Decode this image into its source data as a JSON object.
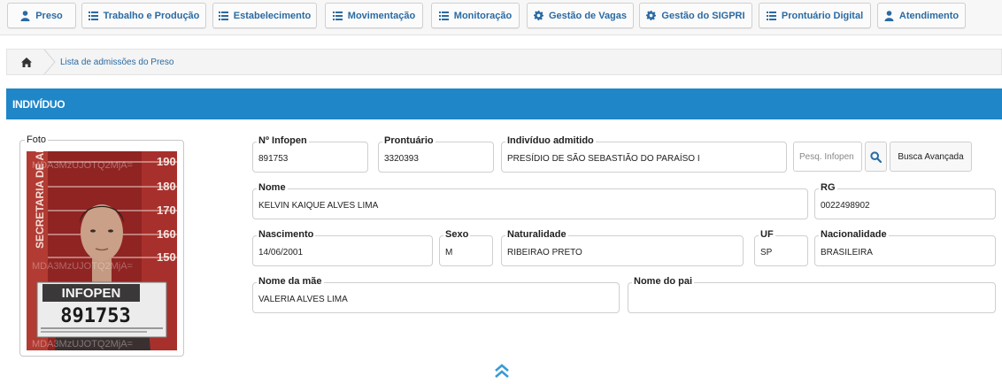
{
  "nav": {
    "items": [
      {
        "label": "Preso",
        "icon": "user-icon"
      },
      {
        "label": "Trabalho e Produção",
        "icon": "list-icon"
      },
      {
        "label": "Estabelecimento",
        "icon": "list-icon"
      },
      {
        "label": "Movimentação",
        "icon": "list-icon"
      },
      {
        "label": "Monitoração",
        "icon": "list-icon"
      },
      {
        "label": "Gestão de Vagas",
        "icon": "gear-icon"
      },
      {
        "label": "Gestão do SIGPRI",
        "icon": "gear-icon"
      },
      {
        "label": "Prontuário Digital",
        "icon": "list-icon"
      },
      {
        "label": "Atendimento",
        "icon": "user-icon"
      }
    ],
    "accent_color": "#2a6aa3"
  },
  "breadcrumb": {
    "home_icon": "home-icon",
    "link": "Lista de admissões do Preso"
  },
  "section": {
    "title": "INDIVÍDUO",
    "color": "#1f86c8"
  },
  "photo": {
    "label": "Foto",
    "height_marks": [
      "190",
      "180",
      "170",
      "160",
      "150"
    ],
    "side_text": "SECRETARIA DE ADM",
    "placard_title": "INFOPEN",
    "placard_number": "891753",
    "watermark": "MDA3MzUJOTQ2MjA="
  },
  "fields": {
    "infopen": {
      "label": "Nº Infopen",
      "value": "891753"
    },
    "prontuario": {
      "label": "Prontuário",
      "value": "3320393"
    },
    "admitido": {
      "label": "Indivíduo admitido",
      "value": "PRESÍDIO DE SÃO SEBASTIÃO DO PARAÍSO I"
    },
    "nome": {
      "label": "Nome",
      "value": "KELVIN KAIQUE ALVES LIMA"
    },
    "rg": {
      "label": "RG",
      "value": "0022498902"
    },
    "nascimento": {
      "label": "Nascimento",
      "value": "14/06/2001"
    },
    "sexo": {
      "label": "Sexo",
      "value": "M"
    },
    "naturalidade": {
      "label": "Naturalidade",
      "value": "RIBEIRAO PRETO"
    },
    "uf": {
      "label": "UF",
      "value": "SP"
    },
    "nacionalidade": {
      "label": "Nacionalidade",
      "value": "BRASILEIRA"
    },
    "mae": {
      "label": "Nome da mãe",
      "value": "VALERIA ALVES LIMA"
    },
    "pai": {
      "label": "Nome do pai",
      "value": ""
    }
  },
  "search": {
    "placeholder": "Pesq. Infopen",
    "icon": "search-icon",
    "advanced_label": "Busca Avançada"
  },
  "footer": {
    "icon": "double-chevron-up-icon"
  }
}
